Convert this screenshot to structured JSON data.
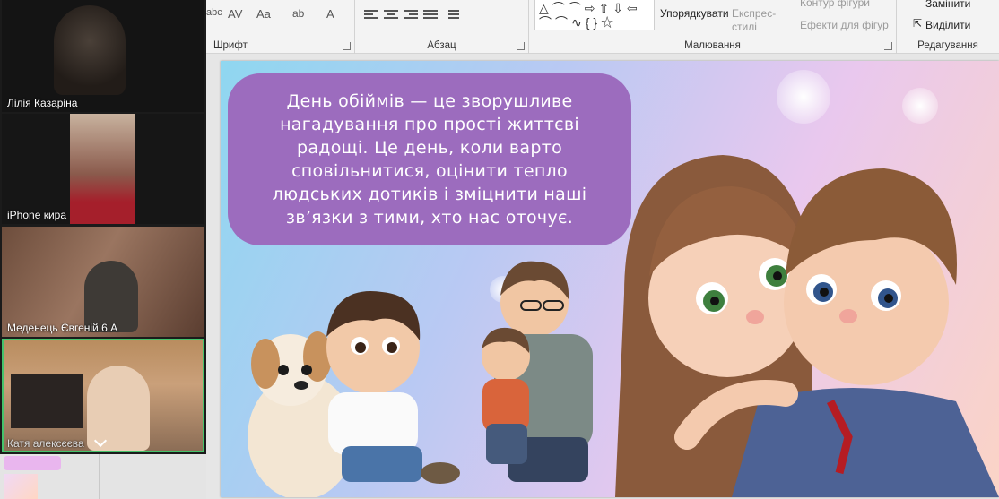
{
  "ribbon": {
    "font_group_label": "Шрифт",
    "paragraph_group_label": "Абзац",
    "drawing_group_label": "Малювання",
    "editing_group_label": "Редагування",
    "font_tools": {
      "clear_format": "abc",
      "spacing": "AV",
      "case": "Aa",
      "highlight": "ab",
      "font_color": "A"
    },
    "arrange_label": "Упорядкувати",
    "quick_styles_label": "Експрес-\nстилі",
    "shape_outline_label": "Контур фігури",
    "shape_effects_label": "Ефекти для фігур",
    "replace_label": "Замінити",
    "select_label": "Виділити",
    "shapes_row1": "△⌒⌒⇨⇧⇩⇦",
    "shapes_row2": "⌒⌒∿{}☆"
  },
  "participants": [
    {
      "name": "Лілія Казаріна"
    },
    {
      "name": "iPhone кира"
    },
    {
      "name": "Меденець Євгеній 6 А"
    },
    {
      "name": "Катя алексєєва",
      "active": true
    }
  ],
  "slide": {
    "text": "День обіймів — це зворушливе нагадування про прості життєві радощі. Це день, коли варто сповільнитися, оцінити тепло людських дотиків і зміцнити наші зв’язки з тими, хто нас оточує."
  },
  "colors": {
    "bubble": "#9c6cbe",
    "active_speaker": "#45c36b"
  }
}
